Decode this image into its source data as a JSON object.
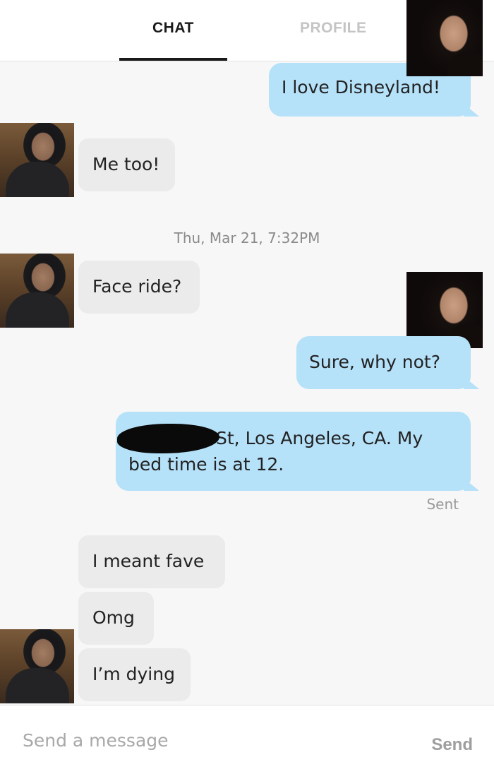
{
  "tabs": {
    "chat": "CHAT",
    "profile": "PROFILE"
  },
  "messages": {
    "m1": "I love Disneyland!",
    "m2": "Me too!",
    "timestamp": "Thu, Mar 21, 7:32PM",
    "m3": "Face ride?",
    "m4": "Sure, why not?",
    "m5": "St, Los Angeles, CA. My bed time is at 12.",
    "sent_status": "Sent",
    "m6": "I meant fave",
    "m7": "Omg",
    "m8": "I’m dying"
  },
  "composer": {
    "placeholder": "Send a message",
    "send_label": "Send"
  },
  "colors": {
    "outgoing_bubble": "#b5e1f9",
    "incoming_bubble": "#ebebeb"
  }
}
